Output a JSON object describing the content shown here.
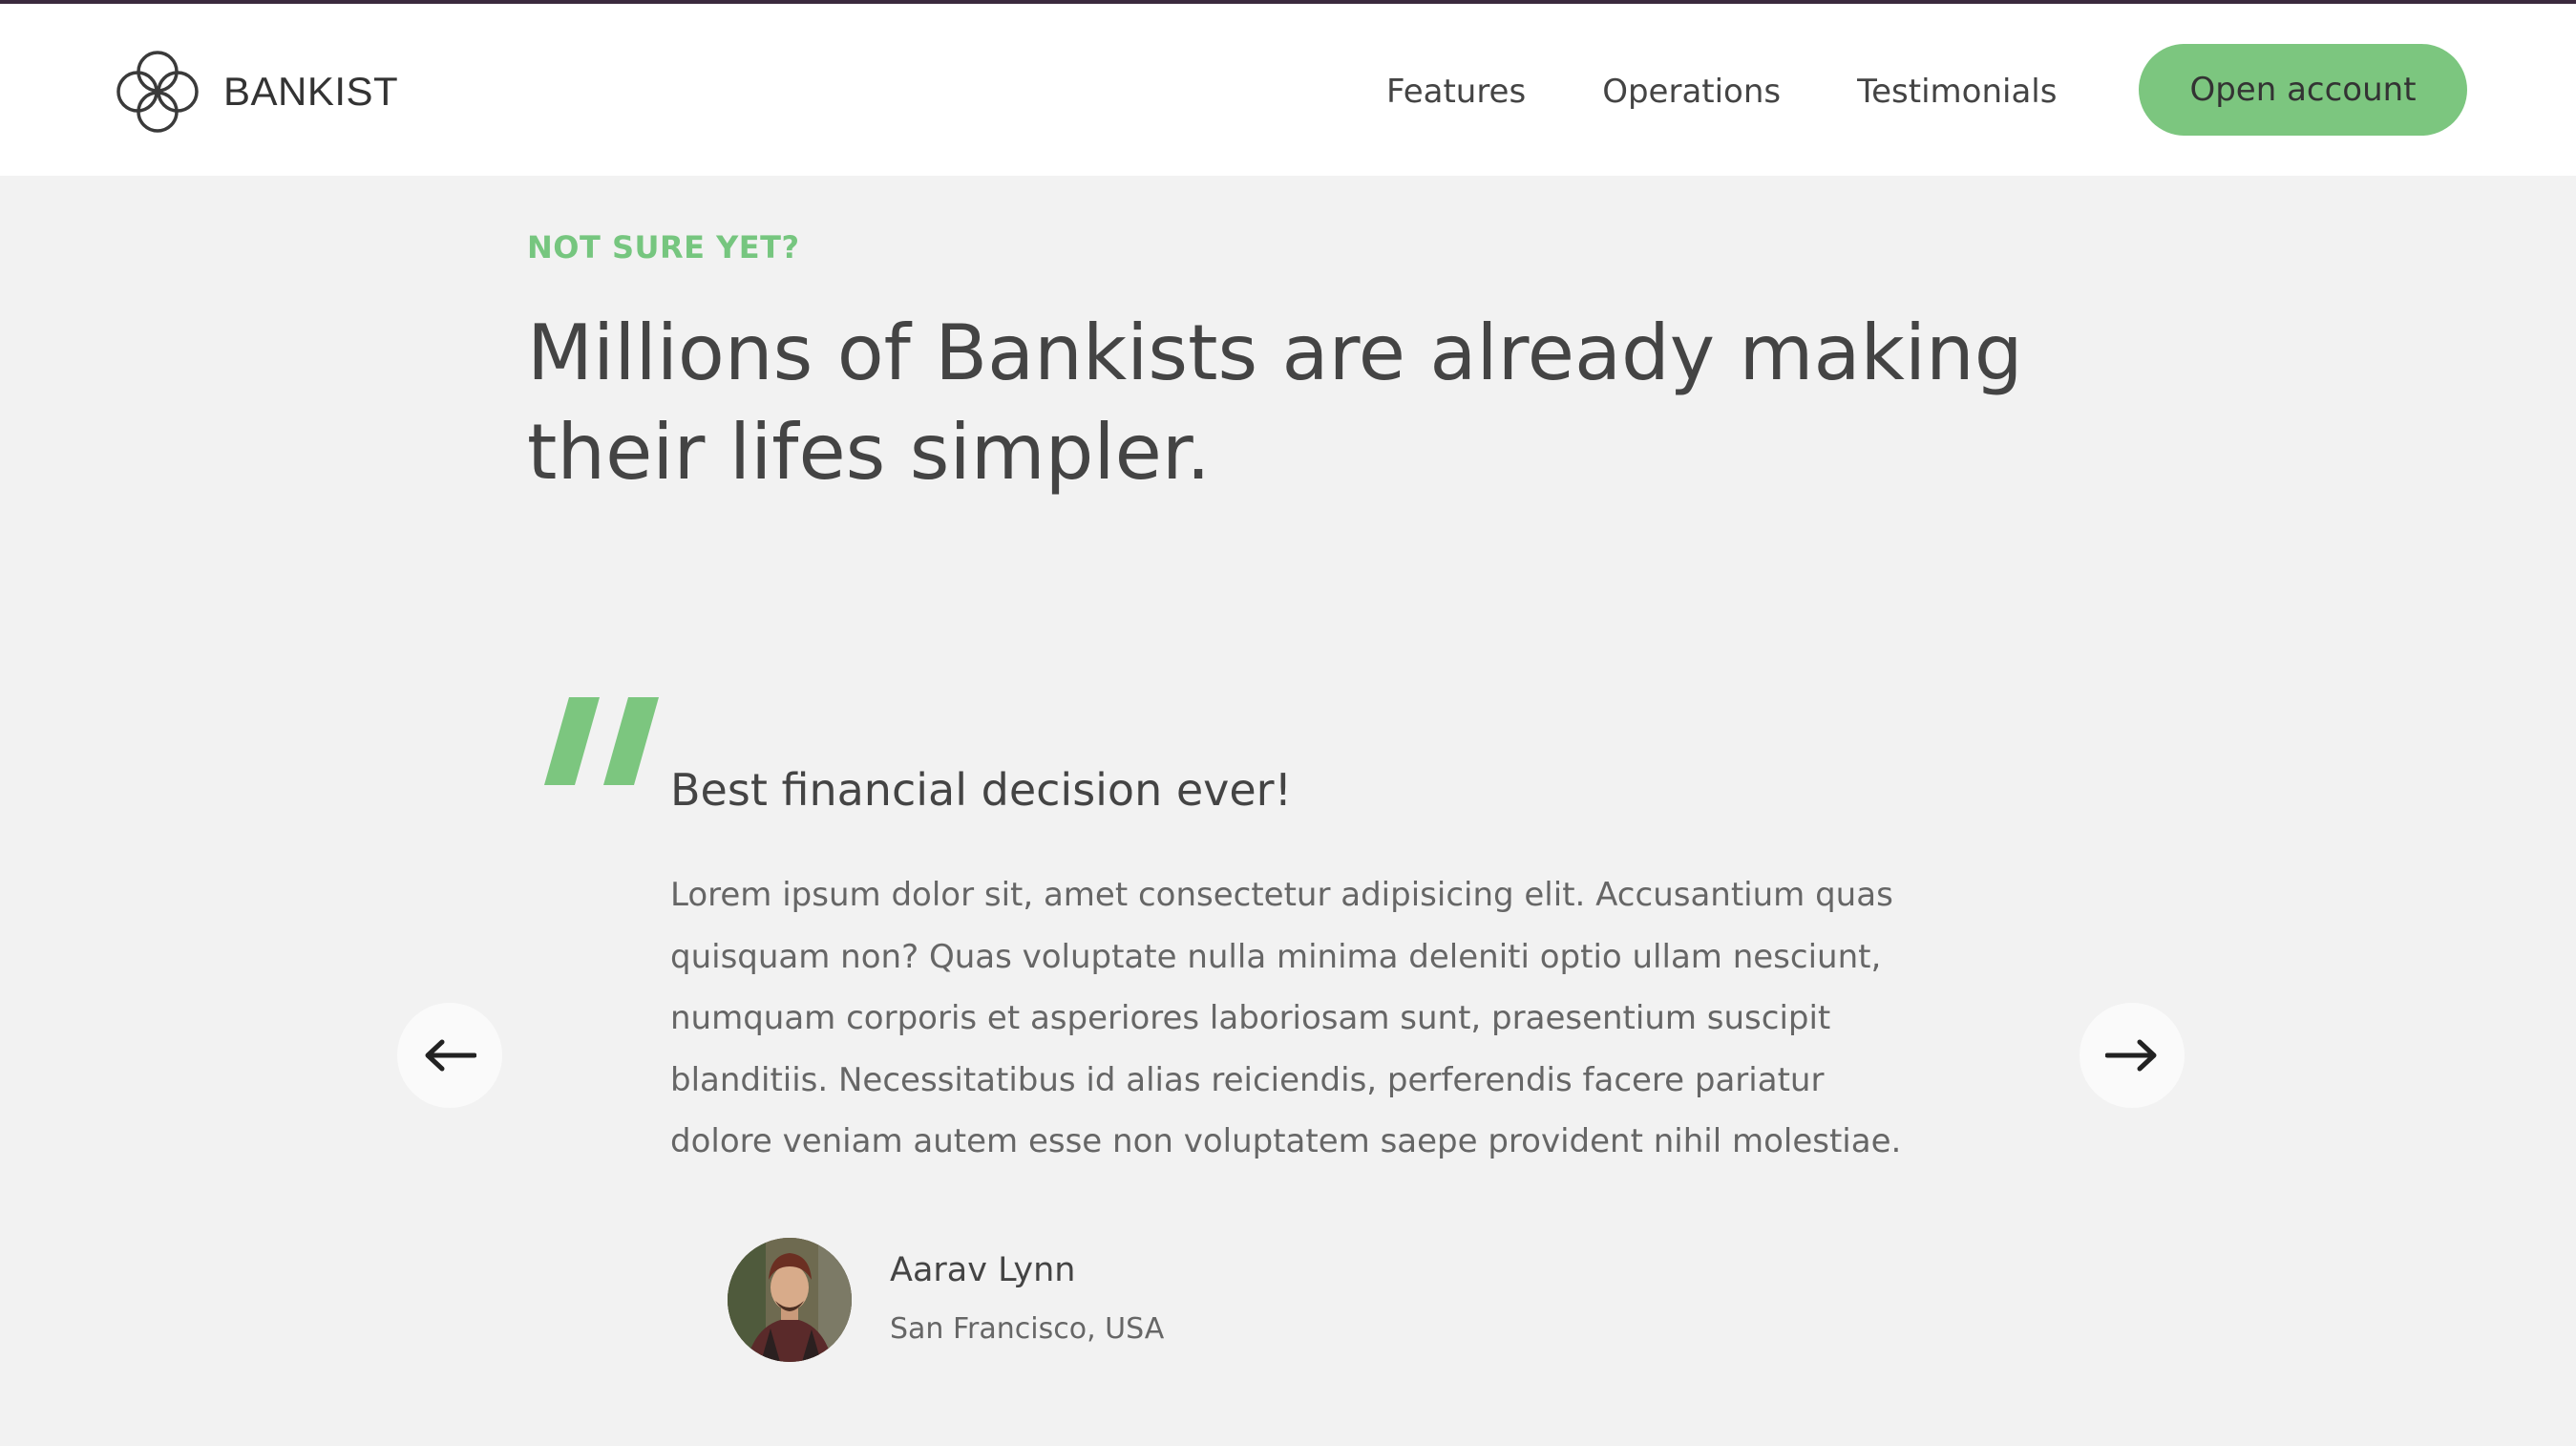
{
  "brand": {
    "name": "BANKIST",
    "accent_color": "#7cc67f",
    "logo_icon": "four-loop-knot-icon"
  },
  "nav": {
    "links": [
      "Features",
      "Operations",
      "Testimonials"
    ],
    "cta_label": "Open account"
  },
  "section": {
    "eyebrow": "NOT SURE YET?",
    "headline": "Millions of Bankists are already making their lifes simpler."
  },
  "testimonial": {
    "title": "Best financial decision ever!",
    "text": "Lorem ipsum dolor sit, amet consectetur adipisicing elit. Accusantium quas quisquam non? Quas voluptate nulla minima deleniti optio ullam nesciunt, numquam corporis et asperiores laboriosam sunt, praesentium suscipit blanditiis. Necessitatibus id alias reiciendis, perferendis facere pariatur dolore veniam autem esse non voluptatem saepe provident nihil molestiae.",
    "author_name": "Aarav Lynn",
    "author_location": "San Francisco, USA",
    "quote_icon": "quote-mark-icon"
  },
  "slider": {
    "prev_icon": "arrow-left-icon",
    "next_icon": "arrow-right-icon"
  }
}
